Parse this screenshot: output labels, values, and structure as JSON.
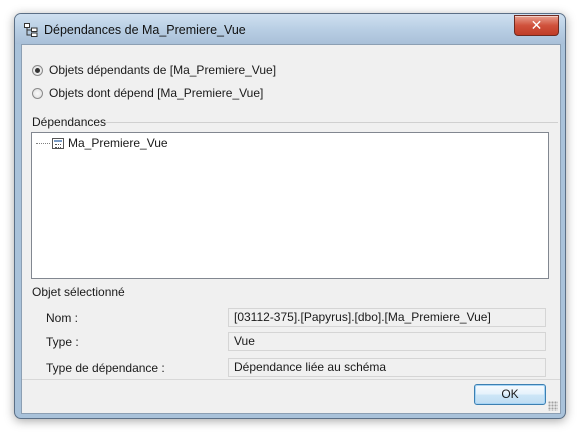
{
  "window": {
    "title": "Dépendances de Ma_Premiere_Vue",
    "close_glyph": "✕"
  },
  "options": {
    "dependents_label": "Objets dépendants de [Ma_Premiere_Vue]",
    "dependents_checked": true,
    "depends_on_label": "Objets dont dépend [Ma_Premiere_Vue]",
    "depends_on_checked": false
  },
  "dependencies": {
    "label": "Dépendances",
    "tree": [
      {
        "label": "Ma_Premiere_Vue",
        "icon": "view-icon"
      }
    ]
  },
  "selected_object": {
    "header": "Objet sélectionné",
    "name_label": "Nom :",
    "name_value": "[03112-375].[Papyrus].[dbo].[Ma_Premiere_Vue]",
    "type_label": "Type :",
    "type_value": "Vue",
    "dependency_type_label": "Type de dépendance :",
    "dependency_type_value": "Dépendance liée au schéma"
  },
  "footer": {
    "ok_label": "OK"
  }
}
